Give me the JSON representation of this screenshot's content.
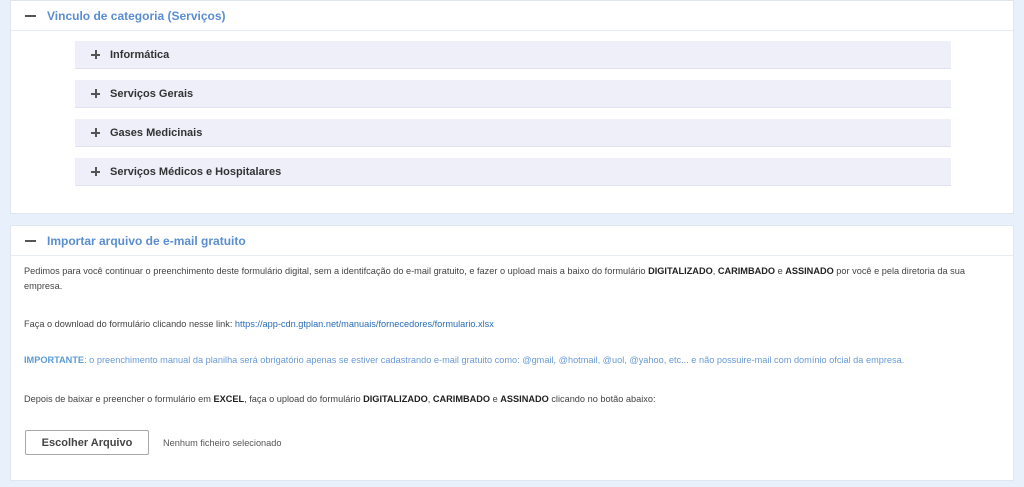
{
  "category_panel": {
    "title": "Vinculo de categoria (Serviços)",
    "items": [
      {
        "label": "Informática"
      },
      {
        "label": "Serviços Gerais"
      },
      {
        "label": "Gases Medicinais"
      },
      {
        "label": "Serviços Médicos e Hospitalares"
      }
    ]
  },
  "import_panel": {
    "title": "Importar arquivo de e-mail gratuito",
    "para1": {
      "t1": "Pedimos para você continuar o preenchimento deste formulário digital, sem a identifcação do e-mail gratuito, e fazer o upload mais a baixo do formulário ",
      "b1": "DIGITALIZADO",
      "t2": ", ",
      "b2": "CARIMBADO",
      "t3": " e ",
      "b3": "ASSINADO",
      "t4": " por você e pela diretoria da sua empresa."
    },
    "para2": {
      "text": "Faça o download do formulário clicando nesse link: ",
      "link": "https://app-cdn.gtplan.net/manuais/fornecedores/formulario.xlsx"
    },
    "para3": {
      "label": "IMPORTANTE",
      "text": ": o preenchimento manual da planilha será obrigatório apenas se estiver cadastrando e-mail gratuito como: @gmail, @hotmail, @uol, @yahoo, etc... e não possuire-mail com domínio ofcial da empresa."
    },
    "para4": {
      "t1": "Depois de baixar e preencher o formulário em ",
      "b1": "EXCEL",
      "t2": ", faça o upload do formulário ",
      "b2": "DIGITALIZADO",
      "t3": ", ",
      "b3": "CARIMBADO",
      "t4": " e ",
      "b4": "ASSINADO",
      "t5": " clicando no botão abaixo:"
    },
    "file_button": "Escolher Arquivo",
    "file_status": "Nenhum ficheiro selecionado"
  }
}
